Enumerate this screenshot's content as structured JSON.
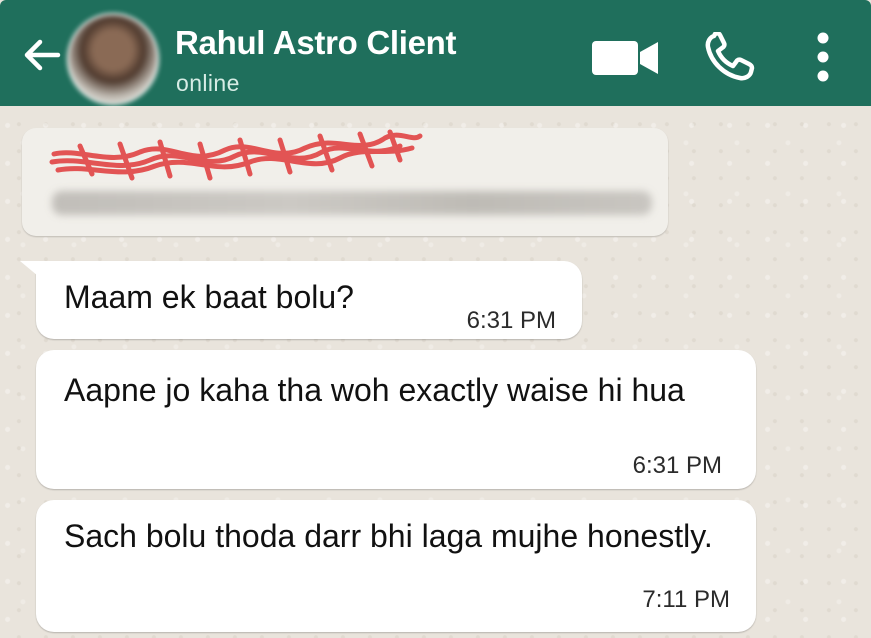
{
  "header": {
    "contact_name": "Rahul Astro Client",
    "status": "online",
    "background_color": "#1f6f5c"
  },
  "icons": {
    "back": "arrow-left-icon",
    "video": "video-camera-icon",
    "call": "phone-icon",
    "menu": "more-vertical-icon"
  },
  "messages": [
    {
      "text": "Maam ek baat bolu?",
      "time": "6:31 PM"
    },
    {
      "text": "Aapne jo kaha tha woh exactly waise hi hua",
      "time": "6:31 PM"
    },
    {
      "text": "Sach bolu thoda darr bhi laga mujhe honestly.",
      "time": "7:11 PM"
    }
  ],
  "colors": {
    "bubble": "#ffffff",
    "chat_background": "#e9e4dc",
    "redaction_scribble": "#e03a3a"
  }
}
